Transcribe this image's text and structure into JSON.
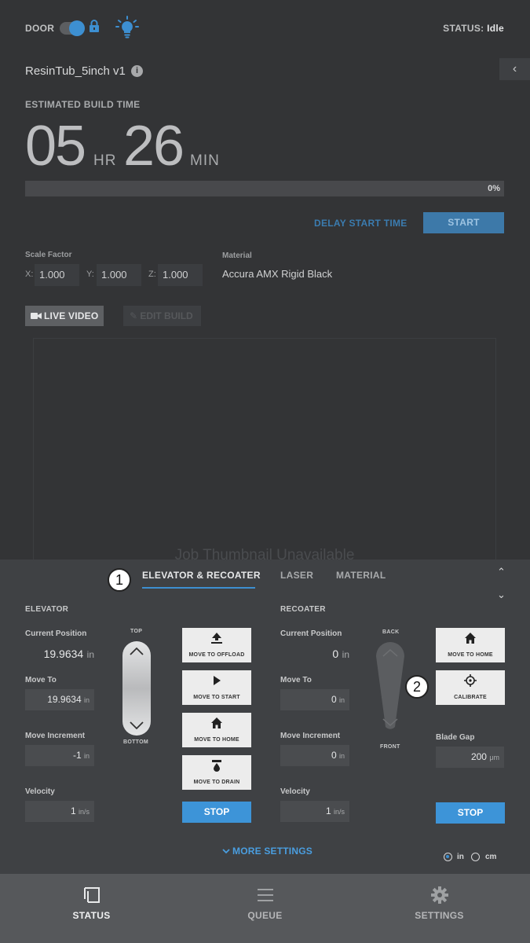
{
  "header": {
    "door_label": "DOOR",
    "status_label": "STATUS:",
    "status_value": "Idle"
  },
  "job": {
    "name": "ResinTub_5inch v1",
    "info_glyph": "i",
    "collapse_glyph": "‹"
  },
  "build_time": {
    "label": "ESTIMATED BUILD TIME",
    "hours": "05",
    "hours_unit": "HR",
    "minutes": "26",
    "minutes_unit": "MIN"
  },
  "progress": {
    "percent_text": "0%",
    "fraction": 0
  },
  "actions": {
    "delay_start": "DELAY START TIME",
    "start": "START"
  },
  "scale": {
    "label": "Scale Factor",
    "x_label": "X:",
    "x_value": "1.000",
    "y_label": "Y:",
    "y_value": "1.000",
    "z_label": "Z:",
    "z_value": "1.000"
  },
  "material": {
    "label": "Material",
    "value": "Accura AMX Rigid Black"
  },
  "video": {
    "live_video": "LIVE VIDEO",
    "edit_build": "EDIT BUILD"
  },
  "thumbnail": {
    "text": "Job Thumbnail Unavailable"
  },
  "panel": {
    "tabs": [
      "ELEVATOR & RECOATER",
      "LASER",
      "MATERIAL"
    ],
    "callout_1": "1",
    "callout_2": "2",
    "caret_up": "⌃",
    "caret_down": "⌄"
  },
  "elevator": {
    "title": "ELEVATOR",
    "current_position_label": "Current Position",
    "current_position_value": "19.9634",
    "current_position_unit": "in",
    "move_to_label": "Move To",
    "move_to_value": "19.9634",
    "move_to_unit": "in",
    "move_increment_label": "Move Increment",
    "move_increment_value": "-1",
    "move_increment_unit": "in",
    "velocity_label": "Velocity",
    "velocity_value": "1",
    "velocity_unit": "in/s",
    "slider_top": "TOP",
    "slider_bottom": "BOTTOM",
    "btn_offload": "MOVE TO OFFLOAD",
    "btn_start": "MOVE TO START",
    "btn_home": "MOVE TO HOME",
    "btn_drain": "MOVE TO DRAIN",
    "stop": "STOP"
  },
  "recoater": {
    "title": "RECOATER",
    "current_position_label": "Current Position",
    "current_position_value": "0",
    "current_position_unit": "in",
    "move_to_label": "Move To",
    "move_to_value": "0",
    "move_to_unit": "in",
    "move_increment_label": "Move Increment",
    "move_increment_value": "0",
    "move_increment_unit": "in",
    "velocity_label": "Velocity",
    "velocity_value": "1",
    "velocity_unit": "in/s",
    "slider_back": "BACK",
    "slider_front": "FRONT",
    "btn_home": "MOVE TO HOME",
    "btn_calibrate": "CALIBRATE",
    "blade_gap_label": "Blade Gap",
    "blade_gap_value": "200",
    "blade_gap_unit": "μm",
    "stop": "STOP"
  },
  "more_settings": "MORE SETTINGS",
  "units": {
    "in": "in",
    "cm": "cm",
    "selected": "in"
  },
  "nav": {
    "status": "STATUS",
    "queue": "QUEUE",
    "settings": "SETTINGS"
  },
  "colors": {
    "accent": "#3d8fd1",
    "background": "#333436",
    "panel": "#3f4144",
    "nav": "#56585b"
  }
}
